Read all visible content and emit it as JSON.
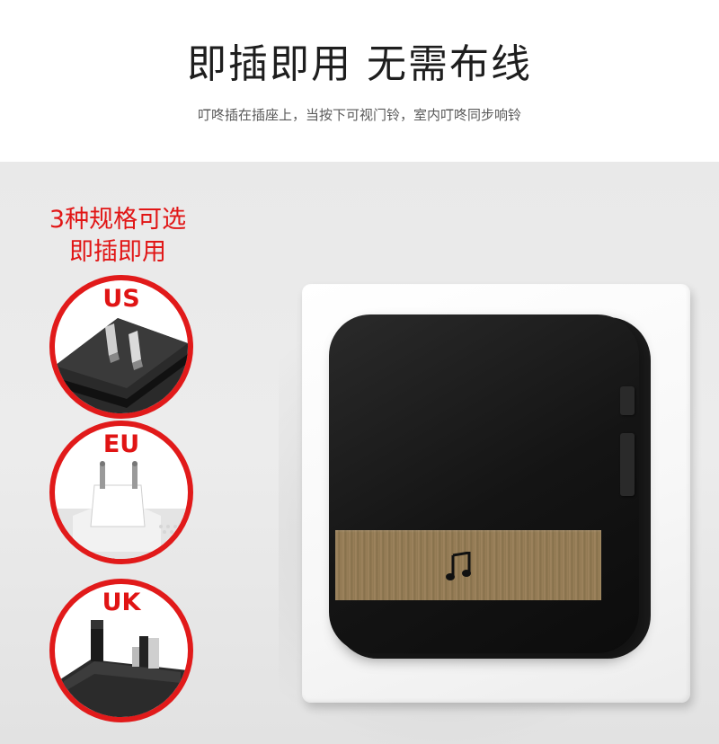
{
  "header": {
    "headline": "即插即用 无需布线",
    "subline": "叮咚插在插座上，当按下可视门铃，室内叮咚同步响铃"
  },
  "caption": {
    "line1": "3种规格可选",
    "line2": "即插即用"
  },
  "plugs": [
    {
      "label": "US",
      "icon": "us-plug-icon"
    },
    {
      "label": "EU",
      "icon": "eu-plug-icon"
    },
    {
      "label": "UK",
      "icon": "uk-plug-icon"
    }
  ],
  "device": {
    "icon": "music-note-icon"
  },
  "colors": {
    "accent_red": "#e11616",
    "device_black": "#141414",
    "gold_band": "#9a8059",
    "wall": "#e9e9e9"
  }
}
